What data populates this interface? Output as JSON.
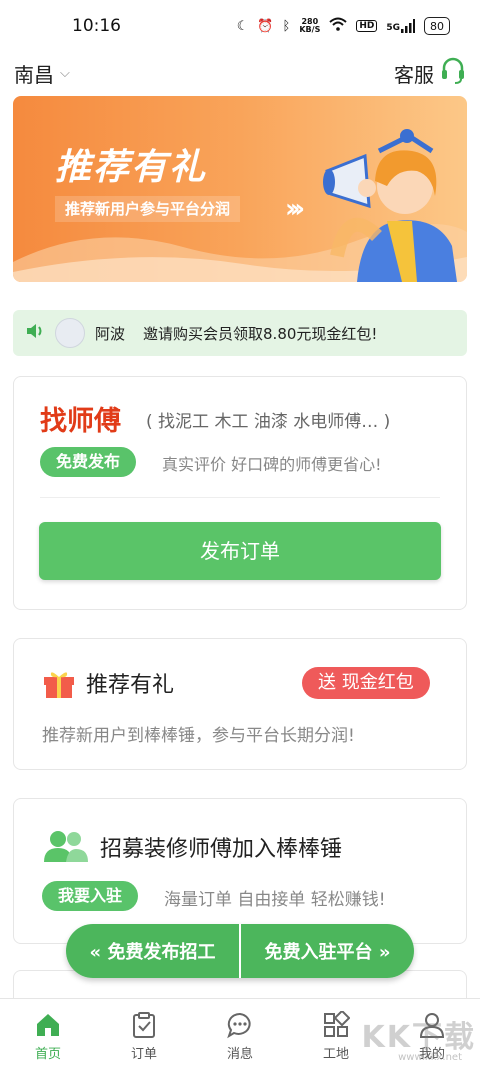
{
  "status_bar": {
    "time": "10:16",
    "net_speed_value": "280",
    "net_speed_unit": "KB/S",
    "hd_label": "HD",
    "signal_label": "5G",
    "battery": "80"
  },
  "header": {
    "city": "南昌",
    "service_label": "客服"
  },
  "banner": {
    "title": "推荐有礼",
    "subtitle": "推荐新用户参与平台分润",
    "arrows": "›››"
  },
  "notice": {
    "user": "阿波",
    "text": "邀请购买会员领取8.80元现金红包!"
  },
  "find_master": {
    "title": "找师傅",
    "hint": "( 找泥工 木工 油漆 水电师傅… )",
    "tag": "免费发布",
    "desc": "真实评价 好口碑的师傅更省心!",
    "publish_button": "发布订单"
  },
  "referral": {
    "title": "推荐有礼",
    "badge": "送 现金红包",
    "desc": "推荐新用户到棒棒锤，参与平台长期分润!"
  },
  "recruit": {
    "title": "招募装修师傅加入棒棒锤",
    "tag": "我要入驻",
    "desc": "海量订单 自由接单 轻松赚钱!"
  },
  "float_bar": {
    "left": "« 免费发布招工",
    "right": "免费入驻平台 »"
  },
  "tabs": [
    {
      "label": "首页",
      "icon": "home-icon"
    },
    {
      "label": "订单",
      "icon": "order-icon"
    },
    {
      "label": "消息",
      "icon": "message-icon"
    },
    {
      "label": "工地",
      "icon": "site-icon"
    },
    {
      "label": "我的",
      "icon": "profile-icon"
    }
  ],
  "watermark": {
    "main": "KK下载",
    "sub": "www.kkx.net"
  },
  "colors": {
    "accent_green": "#5ac468",
    "title_red": "#e13b18",
    "badge_red": "#ef5a5a",
    "banner_orange": "#f58a3e"
  }
}
